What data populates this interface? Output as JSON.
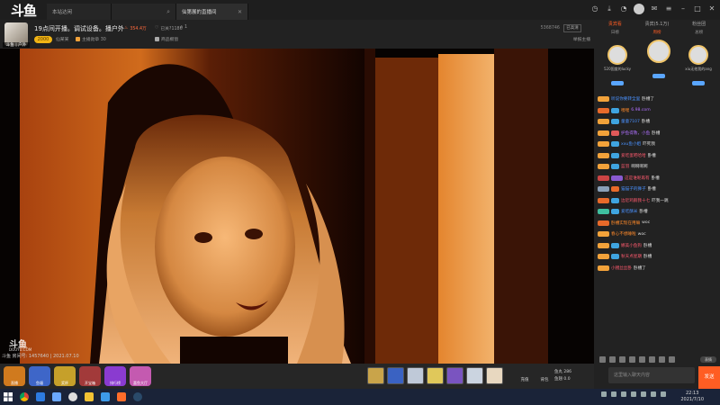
{
  "app": {
    "logo": "斗鱼",
    "tabs": [
      {
        "label": "本站达闲"
      },
      {
        "label": ""
      },
      {
        "label": "仙第展的直播间"
      }
    ]
  },
  "header": {
    "title": "19点间开播。调试设备。播户外",
    "room_name": "仙某某",
    "avatar_caption": "斗鱼 | 户外",
    "level": "2000",
    "heat": "354.4万",
    "followers": "已关?1186",
    "gift_count": "1",
    "fans_badge": "主播勋章 30",
    "room_id": "5368746",
    "quality": "已高清",
    "report": "举报主播",
    "extra": "商品橱窗"
  },
  "video": {
    "wm_logo": "斗鱼",
    "wm_sub": "DOUYU.COM",
    "status": "斗鱼 房间号: 1457640 | 2021.07.10"
  },
  "giftbar": {
    "left_items": [
      {
        "label": "直播",
        "color": "#d07a1e"
      },
      {
        "label": "鱼塘",
        "color": "#3e66c8"
      },
      {
        "label": "奖杯",
        "color": "#c6a02a"
      },
      {
        "label": "开宝箱",
        "color": "#a23a3a"
      },
      {
        "label": "排行榜",
        "color": "#8a3bd0"
      },
      {
        "label": "喜鱼大厅",
        "color": "#c45ab0"
      }
    ],
    "gifts": [
      "#c9a44a",
      "#3a62c2",
      "#bfc9d8",
      "#e0c85a",
      "#7a54c0",
      "#cbd4e0",
      "#e8d8c0"
    ],
    "actions": [
      "充值",
      "背包"
    ],
    "stats_1": "鱼丸 286",
    "stats_2": "鱼翅 0.0"
  },
  "side": {
    "tabs": [
      "贵宾看",
      "贵宾(5.1万)",
      "粉丝团"
    ],
    "sub_tabs": [
      "日榜",
      "周榜",
      "总榜"
    ],
    "podium": [
      {
        "name": "520国度的lucky"
      },
      {
        "name": ""
      },
      {
        "name": "xiu无他我的ang"
      }
    ],
    "messages": [
      {
        "user": "听说你要转全里",
        "text": "卧槽了"
      },
      {
        "user": "嘿嘿",
        "text": "6.98.com"
      },
      {
        "user": "童童7107",
        "text": "卧槽"
      },
      {
        "user": "护鱼得救，小鱼",
        "text": "卧槽"
      },
      {
        "user": "xxu鱼小姐",
        "text": "吓死我"
      },
      {
        "user": "爱吃蛋吧哈哈",
        "text": "卧槽"
      },
      {
        "user": "蓝羽",
        "text": "啊啊啊啊"
      },
      {
        "user": "这是谁呢再有",
        "text": "卧槽"
      },
      {
        "user": "猫猫子的狮子",
        "text": "卧槽"
      },
      {
        "user": "边近鸡鹅我十七",
        "text": "吓我一跳"
      },
      {
        "user": "爱吃酥米",
        "text": "卧槽"
      },
      {
        "user": "卧槽实现在用嘛",
        "text": "woc"
      },
      {
        "user": "春心不想睡啦",
        "text": "woc"
      },
      {
        "user": "娜美小鱼狗",
        "text": "卧槽"
      },
      {
        "user": "秋天点星期",
        "text": "卧槽"
      },
      {
        "user": "小猪丝丝卧",
        "text": "卧槽了"
      }
    ],
    "pill": "表情",
    "input_placeholder": "这里输入聊天内容",
    "send": "发送"
  },
  "taskbar": {
    "time": "22:13",
    "date": "2021/7/10"
  },
  "colors": {
    "accent": "#ff5d23",
    "user_blue": "#4a92ff",
    "badge_orange": "#f2a23a"
  }
}
